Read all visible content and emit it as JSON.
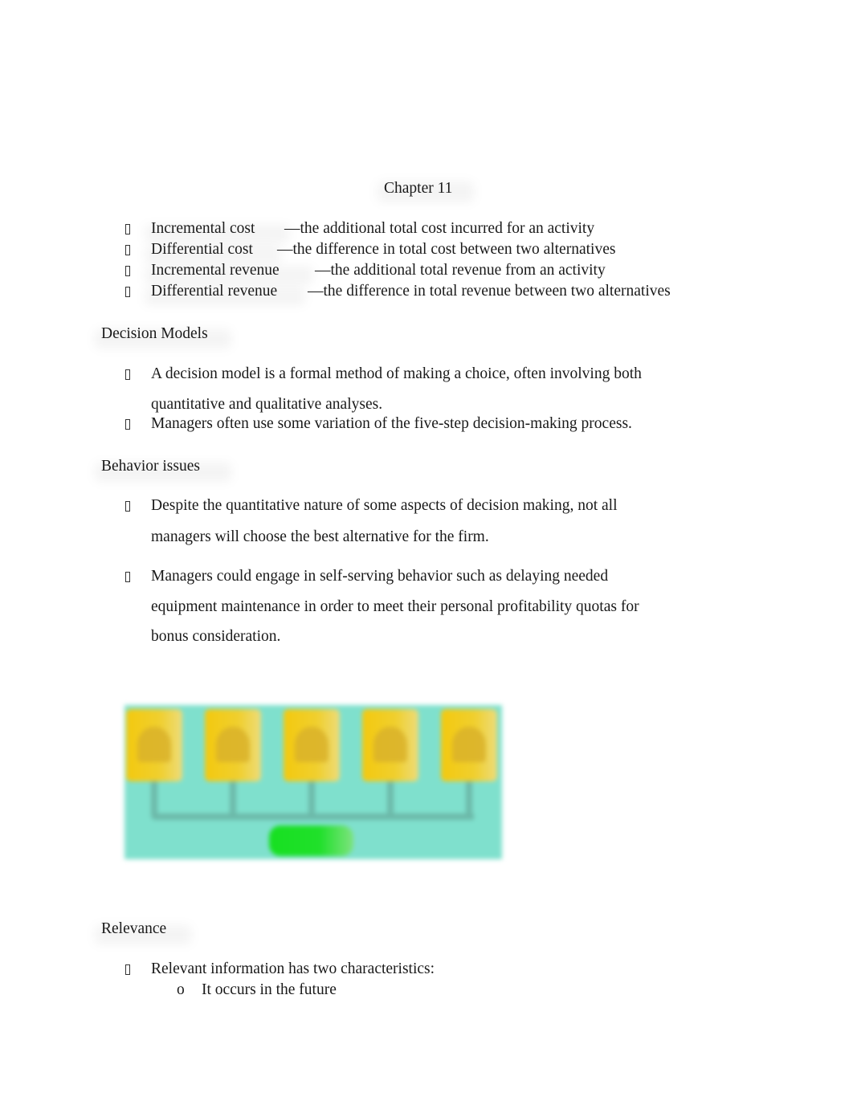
{
  "document": {
    "title": "Chapter 11",
    "definitions": [
      {
        "term": "Incremental cost",
        "definition": "—the additional total cost incurred for an activity"
      },
      {
        "term": "Differential cost",
        "definition": "—the difference in total cost between two alternatives"
      },
      {
        "term": "Incremental revenue",
        "definition": "—the additional total revenue from an activity"
      },
      {
        "term": "Differential revenue",
        "definition": "—the difference in total revenue between two alternatives"
      }
    ],
    "sections": [
      {
        "heading": "Decision Models",
        "bullets": [
          {
            "lines": [
              "A decision model is a formal method of making a choice, often involving both",
              "quantitative and qualitative analyses."
            ]
          },
          {
            "lines": [
              "Managers often use some variation of the five-step decision-making process."
            ]
          }
        ]
      },
      {
        "heading": "Behavior issues",
        "bullets": [
          {
            "lines": [
              "Despite the quantitative nature of some aspects of decision making, not all",
              "managers will choose the best alternative for the firm."
            ]
          },
          {
            "lines": [
              "Managers could engage in self-serving behavior such as delaying needed",
              "equipment maintenance in order to meet their personal profitability quotas for",
              "bonus consideration."
            ]
          }
        ]
      },
      {
        "heading": "Relevance",
        "bullets": [
          {
            "lines": [
              "Relevant information has two characteristics:"
            ],
            "sub": [
              {
                "marker": "o",
                "text": "It occurs in the future"
              }
            ]
          }
        ]
      }
    ],
    "figure": {
      "description": "five-step decision-making process diagram (blurred)",
      "colors": {
        "card": "#f3c90f",
        "background": "#7fe0cd",
        "connector": "#6cb9a9",
        "center": "#17e021"
      },
      "step_count": 5
    }
  }
}
